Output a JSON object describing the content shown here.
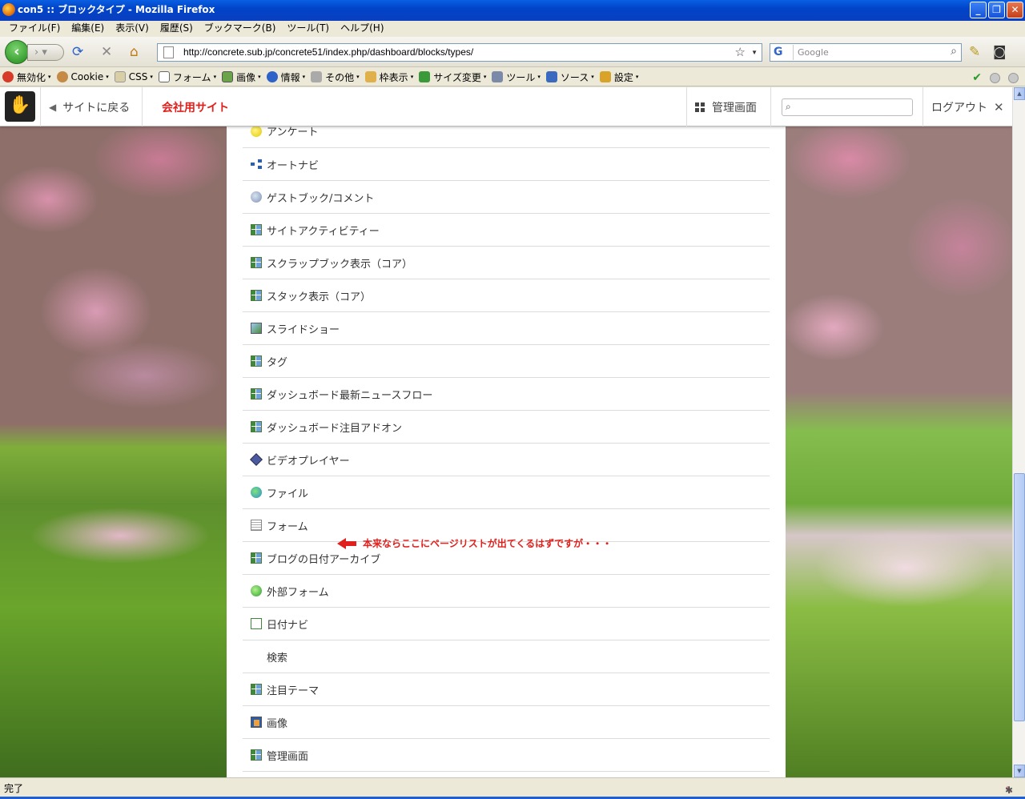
{
  "window": {
    "title": "con5 :: ブロックタイプ - Mozilla Firefox"
  },
  "menu": [
    "ファイル(F)",
    "編集(E)",
    "表示(V)",
    "履歴(S)",
    "ブックマーク(B)",
    "ツール(T)",
    "ヘルプ(H)"
  ],
  "nav": {
    "url": "http://concrete.sub.jp/concrete51/index.php/dashboard/blocks/types/",
    "search_placeholder": "Google",
    "search_engine_letter": "G"
  },
  "devbar": [
    "無効化",
    "Cookie",
    "CSS",
    "フォーム",
    "画像",
    "情報",
    "その他",
    "枠表示",
    "サイズ変更",
    "ツール",
    "ソース",
    "設定"
  ],
  "cms": {
    "back": "サイトに戻る",
    "site_name": "会社用サイト",
    "admin": "管理画面",
    "logout": "ログアウト"
  },
  "blocks": [
    {
      "label": "アンケート",
      "icon": "poll"
    },
    {
      "label": "オートナビ",
      "icon": "nav"
    },
    {
      "label": "ゲストブック/コメント",
      "icon": "guest"
    },
    {
      "label": "サイトアクティビティー",
      "icon": "grid"
    },
    {
      "label": "スクラップブック表示（コア）",
      "icon": "grid"
    },
    {
      "label": "スタック表示（コア）",
      "icon": "grid"
    },
    {
      "label": "スライドショー",
      "icon": "slide"
    },
    {
      "label": "タグ",
      "icon": "grid"
    },
    {
      "label": "ダッシュボード最新ニュースフロー",
      "icon": "grid"
    },
    {
      "label": "ダッシュボード注目アドオン",
      "icon": "grid"
    },
    {
      "label": "ビデオプレイヤー",
      "icon": "video"
    },
    {
      "label": "ファイル",
      "icon": "file"
    },
    {
      "label": "フォーム",
      "icon": "form"
    },
    {
      "label": "ブログの日付アーカイブ",
      "icon": "grid"
    },
    {
      "label": "外部フォーム",
      "icon": "ext"
    },
    {
      "label": "日付ナビ",
      "icon": "date"
    },
    {
      "label": "検索",
      "icon": "search"
    },
    {
      "label": "注目テーマ",
      "icon": "grid"
    },
    {
      "label": "画像",
      "icon": "img"
    },
    {
      "label": "管理画面",
      "icon": "grid"
    }
  ],
  "annotation": "本来ならここにページリストが出てくるはずですが・・・",
  "status": {
    "text": "完了"
  }
}
